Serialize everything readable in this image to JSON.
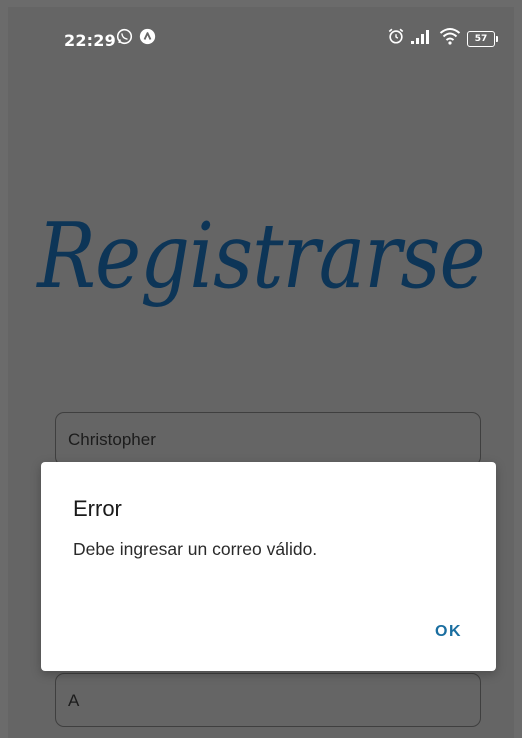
{
  "status_bar": {
    "time": "22:29",
    "battery_level": "57",
    "icons": [
      "whatsapp-icon",
      "notification-app-icon",
      "alarm-icon",
      "signal-icon",
      "wifi-icon",
      "battery-icon"
    ]
  },
  "page": {
    "title": "Registrarse"
  },
  "form": {
    "name_value": "Christopher",
    "last_value": "A"
  },
  "dialog": {
    "title": "Error",
    "message": "Debe ingresar un correo válido.",
    "ok_label": "OK"
  },
  "colors": {
    "overlay_background": "#656565",
    "title_color": "#0d3557",
    "ok_button_color": "#1a6ea0"
  }
}
